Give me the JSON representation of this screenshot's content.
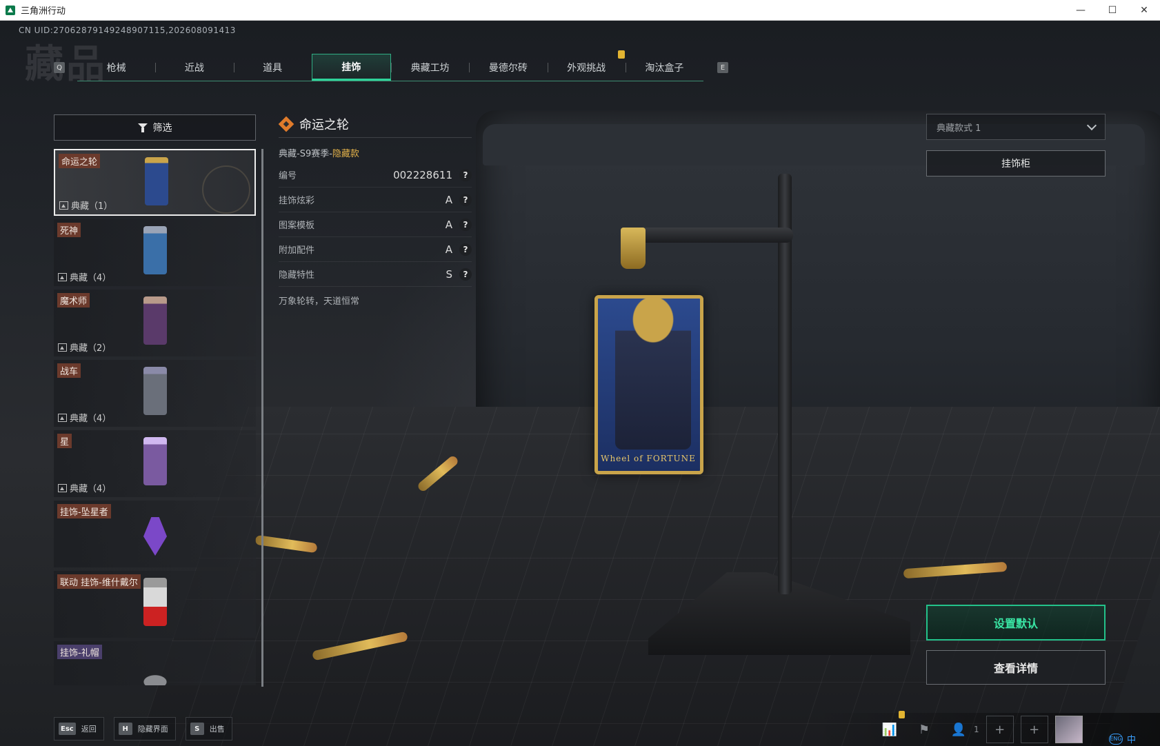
{
  "window": {
    "title": "三角洲行动",
    "minimize_glyph": "—",
    "maximize_glyph": "☐",
    "close_glyph": "✕"
  },
  "page": {
    "heading": "藏品",
    "uid_text": "CN UID:270628791492489071​15,202608091413"
  },
  "tabs": {
    "prev_key": "Q",
    "next_key": "E",
    "items": [
      {
        "label": "枪械"
      },
      {
        "label": "近战"
      },
      {
        "label": "道具"
      },
      {
        "label": "挂饰",
        "active": true
      },
      {
        "label": "典藏工坊"
      },
      {
        "label": "曼德尔砖"
      },
      {
        "label": "外观挑战"
      },
      {
        "label": "淘汰盒子"
      }
    ]
  },
  "filter": {
    "label": "筛选",
    "icon": "filter-icon"
  },
  "items": [
    {
      "tag": "命运之轮",
      "count": "典藏（1）",
      "selected": true,
      "tag_color": "#6b3a2c"
    },
    {
      "tag": "死神",
      "count": "典藏（4）",
      "tag_color": "#6b3a2c"
    },
    {
      "tag": "魔术师",
      "count": "典藏（2）",
      "tag_color": "#6b3a2c"
    },
    {
      "tag": "战车",
      "count": "典藏（4）",
      "tag_color": "#6b3a2c"
    },
    {
      "tag": "星",
      "count": "典藏（4）",
      "tag_color": "#6b3a2c"
    },
    {
      "tag": "挂饰-坠星者",
      "count": "",
      "tag_color": "#6b3a2c"
    },
    {
      "tag": "联动  挂饰-维什戴尔",
      "count": "",
      "tag_color": "#6b3a2c"
    },
    {
      "tag": "挂饰-礼帽",
      "count": "",
      "tag_color": "#4a3f6b"
    }
  ],
  "detail": {
    "title": "命运之轮",
    "season_prefix": "典藏-S9赛季-",
    "season_hidden": "隐藏款",
    "attributes": [
      {
        "label": "编号",
        "value": "002228611"
      },
      {
        "label": "挂饰炫彩",
        "value": "A"
      },
      {
        "label": "图案模板",
        "value": "A"
      },
      {
        "label": "附加配件",
        "value": "A"
      },
      {
        "label": "隐藏特性",
        "value": "S"
      }
    ],
    "help_glyph": "?",
    "description": "万象轮转，天道恒常"
  },
  "right": {
    "style_select": "典藏款式 1",
    "cabinet_button": "挂饰柜",
    "default_button": "设置默认",
    "details_button": "查看详情"
  },
  "model": {
    "caption": "Wheel of FORTUNE"
  },
  "bottom": {
    "hints": [
      {
        "key": "Esc",
        "label": "返回"
      },
      {
        "key": "H",
        "label": "隐藏界面"
      },
      {
        "key": "S",
        "label": "出售"
      }
    ],
    "status": {
      "stats_icon": "📊",
      "flag_icon": "⚑",
      "friends_icon": "👤",
      "friends_count": "1",
      "add_glyph": "+"
    },
    "ime": {
      "lang": "中",
      "badge": "ENG"
    }
  },
  "colors": {
    "accent_green": "#2fd39a",
    "rarity_orange": "#e07b2b",
    "hidden_gold": "#e3b24a"
  }
}
